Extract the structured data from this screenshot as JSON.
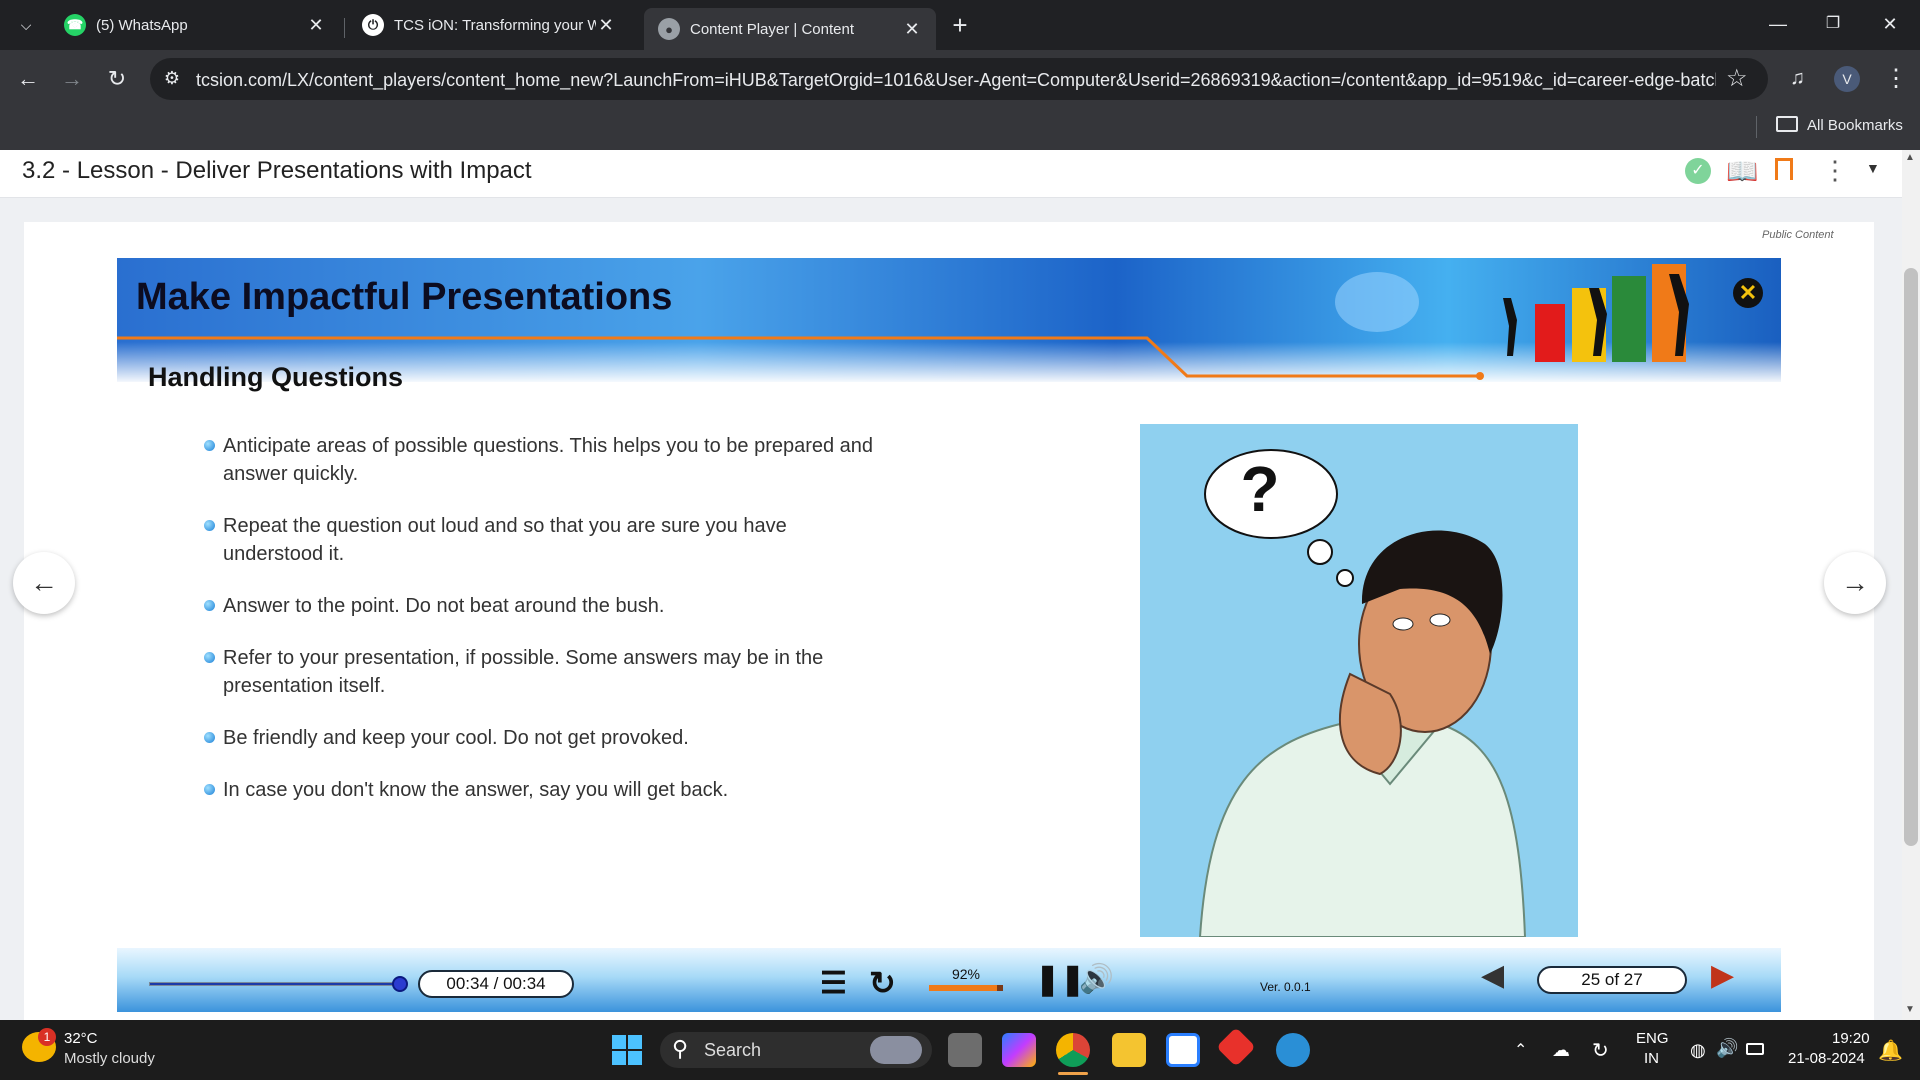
{
  "browser": {
    "tabs": [
      {
        "title": "(5) WhatsApp"
      },
      {
        "title": "TCS iON: Transforming your Wo"
      },
      {
        "title": "Content Player | Content"
      }
    ],
    "url": "tcsion.com/LX/content_players/content_home_new?LaunchFrom=iHUB&TargetOrgid=1016&User-Agent=Computer&Userid=26869319&action=/content&app_id=9519&c_id=career-edge-batch...",
    "profile_initial": "V",
    "bookmarks_label": "All Bookmarks"
  },
  "lesson": {
    "title": "3.2 - Lesson - Deliver Presentations with Impact",
    "public_label": "Public Content"
  },
  "slide": {
    "title": "Make Impactful Presentations",
    "subtitle": "Handling Questions",
    "bullets": [
      "Anticipate areas of possible questions. This helps you to be prepared and answer quickly.",
      "Repeat the question out loud and so that you are sure you have understood it.",
      "Answer to the point. Do not beat around the bush.",
      "Refer to your presentation, if possible. Some answers may be in the presentation itself.",
      "Be friendly and keep your cool. Do not get provoked.",
      "In case you don't know the answer, say you will get back."
    ],
    "thought_symbol": "?"
  },
  "player": {
    "time": "00:34 / 00:34",
    "progress_fraction": 1.0,
    "volume_label": "92%",
    "volume_fraction": 0.92,
    "version": "Ver. 0.0.1",
    "page": "25 of 27"
  },
  "taskbar": {
    "temperature": "32°C",
    "weather": "Mostly cloudy",
    "weather_badge": "1",
    "search_label": "Search",
    "lang1": "ENG",
    "lang2": "IN",
    "time": "19:20",
    "date": "21-08-2024"
  },
  "colors": {
    "accent_orange": "#f07a18",
    "sky": "#8fd0ef",
    "banner_blue": "#2a6fd0"
  }
}
